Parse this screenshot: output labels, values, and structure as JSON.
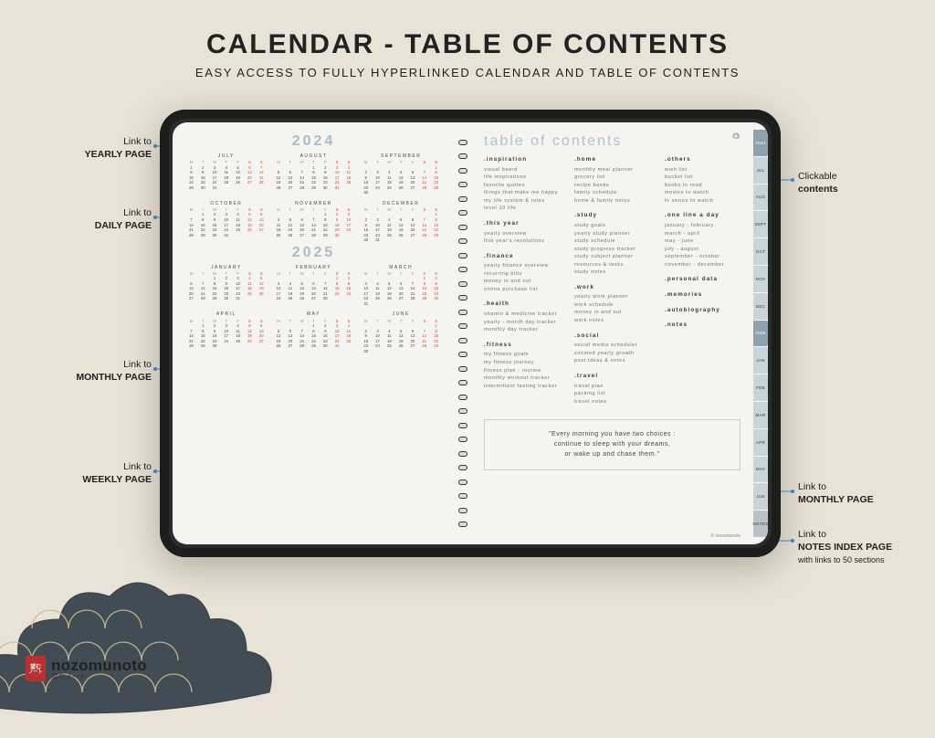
{
  "hero": {
    "title": "CALENDAR - TABLE OF CONTENTS",
    "subtitle": "EASY ACCESS TO FULLY HYPERLINKED CALENDAR AND TABLE OF CONTENTS"
  },
  "callouts": {
    "yearly": {
      "line1": "Link to",
      "line2": "YEARLY PAGE"
    },
    "daily": {
      "line1": "Link to",
      "line2": "DAILY PAGE"
    },
    "monthly_left": {
      "line1": "Link to",
      "line2": "MONTHLY PAGE"
    },
    "weekly": {
      "line1": "Link to",
      "line2": "WEEKLY PAGE"
    },
    "contents": {
      "line1": "Clickable",
      "line2": "contents"
    },
    "monthly_right": {
      "line1": "Link to",
      "line2": "MONTHLY PAGE"
    },
    "notes": {
      "line1": "Link to",
      "line2": "NOTES INDEX PAGE",
      "line3": "with links to 50 sections"
    }
  },
  "years": {
    "y2024": {
      "label": "2024",
      "months": [
        "JULY",
        "AUGUST",
        "SEPTEMBER",
        "OCTOBER",
        "NOVEMBER",
        "DECEMBER"
      ]
    },
    "y2025": {
      "label": "2025",
      "months": [
        "JANUARY",
        "FEBRUARY",
        "MARCH",
        "APRIL",
        "MAY",
        "JUNE"
      ]
    }
  },
  "weekhead": [
    "M",
    "T",
    "W",
    "T",
    "F",
    "S",
    "S"
  ],
  "month_starts": {
    "2024-07": 0,
    "2024-08": 3,
    "2024-09": 6,
    "2024-10": 1,
    "2024-11": 4,
    "2024-12": 6,
    "2025-01": 2,
    "2025-02": 5,
    "2025-03": 5,
    "2025-04": 1,
    "2025-05": 3,
    "2025-06": 6
  },
  "month_len": {
    "2024-07": 31,
    "2024-08": 31,
    "2024-09": 30,
    "2024-10": 31,
    "2024-11": 30,
    "2024-12": 31,
    "2025-01": 31,
    "2025-02": 28,
    "2025-03": 31,
    "2025-04": 30,
    "2025-05": 31,
    "2025-06": 30
  },
  "toc": {
    "title": "table of contents",
    "col1": [
      {
        "h": ".inspiration",
        "items": [
          "visual board",
          "life inspirations",
          "favorite quotes",
          "things that make me happy",
          "my life system & rules",
          "level 10 life"
        ]
      },
      {
        "h": ".this year",
        "items": [
          "yearly overview",
          "this year's resolutions"
        ]
      },
      {
        "h": ".finance",
        "items": [
          "yearly finance overview",
          "recurring bills",
          "money in and out",
          "online purchase list"
        ]
      },
      {
        "h": ".health",
        "items": [
          "vitamin & medicine tracker",
          "yearly - month day tracker",
          "monthly day tracker"
        ]
      },
      {
        "h": ".fitness",
        "items": [
          "my fitness goals",
          "my fitness journey",
          "fitness plan - routine",
          "monthly workout tracker",
          "intermittent fasting tracker"
        ]
      }
    ],
    "col2": [
      {
        "h": ".home",
        "items": [
          "monthly meal planner",
          "grocery list",
          "recipe books",
          "family schedule",
          "home & family notes"
        ]
      },
      {
        "h": ".study",
        "items": [
          "study goals",
          "yearly study planner",
          "study schedule",
          "study progress tracker",
          "study subject planner",
          "resources & tasks",
          "study notes"
        ]
      },
      {
        "h": ".work",
        "items": [
          "yearly work planner",
          "work schedule",
          "money in and out",
          "work notes"
        ]
      },
      {
        "h": ".social",
        "items": [
          "social media scheduler",
          "zoomed yearly growth",
          "post ideas & notes"
        ]
      },
      {
        "h": ".travel",
        "items": [
          "travel plan",
          "packing list",
          "travel notes"
        ]
      }
    ],
    "col3": [
      {
        "h": ".others",
        "items": [
          "wish list",
          "bucket list",
          "books to read",
          "movies to watch",
          "tv series to watch"
        ]
      },
      {
        "h": ".one line a day",
        "items": [
          "january - february",
          "march - april",
          "may - june",
          "july - august",
          "september - october",
          "november - december"
        ]
      },
      {
        "h": ".personal data",
        "items": []
      },
      {
        "h": ".memories",
        "items": []
      },
      {
        "h": ".autobiography",
        "items": []
      },
      {
        "h": ".notes",
        "items": []
      }
    ]
  },
  "quote": {
    "l1": "\"Every morning you have two choices :",
    "l2": "continue to sleep with your dreams,",
    "l3": "or wake up and chase them.\""
  },
  "credit": "© nozomunoto",
  "sidetabs": [
    "2024",
    "JUL",
    "AUG",
    "SEPT",
    "OCT",
    "NOV",
    "DEC",
    "2025",
    "JAN",
    "FEB",
    "MAR",
    "APR",
    "MAY",
    "JUN",
    "NOTES"
  ],
  "brand": {
    "name": "nozomunoto",
    "jp": "望むノート",
    "badge1": "望む",
    "badge2": "ノート"
  }
}
